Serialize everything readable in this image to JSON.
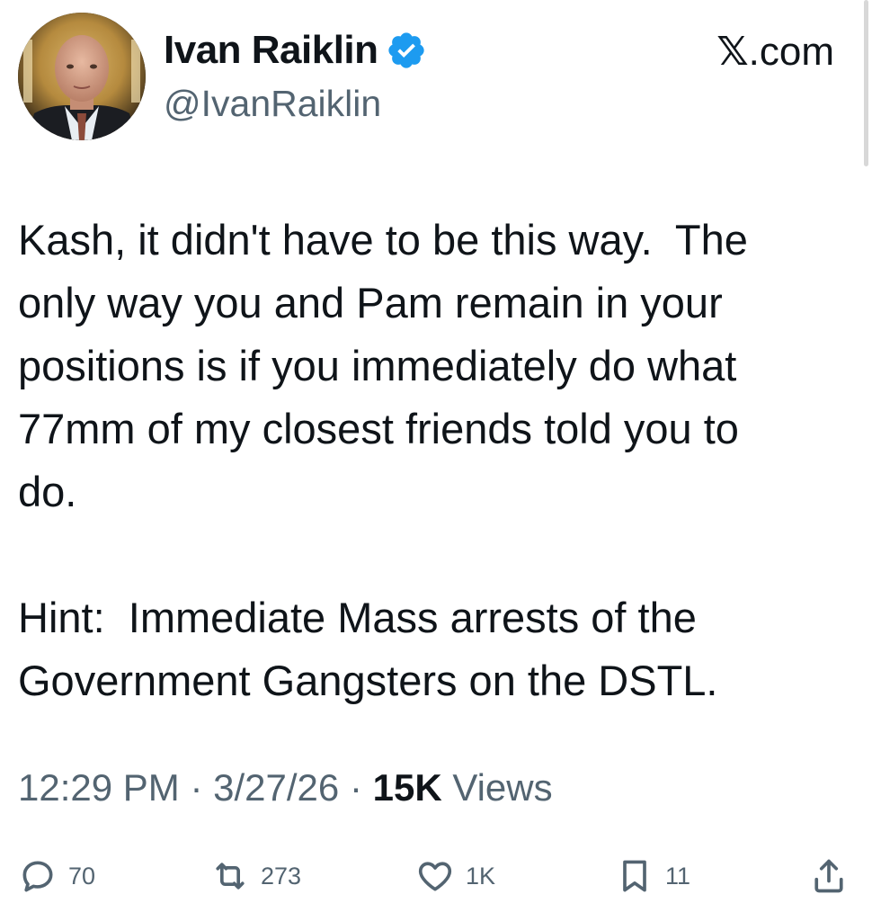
{
  "source": {
    "label": ".com"
  },
  "author": {
    "display_name": "Ivan Raiklin",
    "handle": "@IvanRaiklin",
    "verified": true
  },
  "tweet": {
    "text": "Kash, it didn't have to be this way.  The\nonly way you and Pam remain in your\npositions is if you immediately do what\n77mm of my closest friends told you to\ndo.\n\nHint:  Immediate Mass arrests of the\nGovernment Gangsters on the DSTL.",
    "time": "12:29 PM",
    "separator": "·",
    "date": "3/27/26",
    "views_count": "15K",
    "views_label": "Views"
  },
  "actions": {
    "replies": "70",
    "reposts": "273",
    "likes": "1K",
    "bookmarks": "11"
  },
  "icons": {
    "verified": "verified-badge-icon",
    "reply": "reply-icon",
    "repost": "repost-icon",
    "like": "like-icon",
    "bookmark": "bookmark-icon",
    "share": "share-icon"
  },
  "colors": {
    "verified_blue": "#1d9bf0",
    "text_primary": "#0f1419",
    "text_secondary": "#536471"
  }
}
